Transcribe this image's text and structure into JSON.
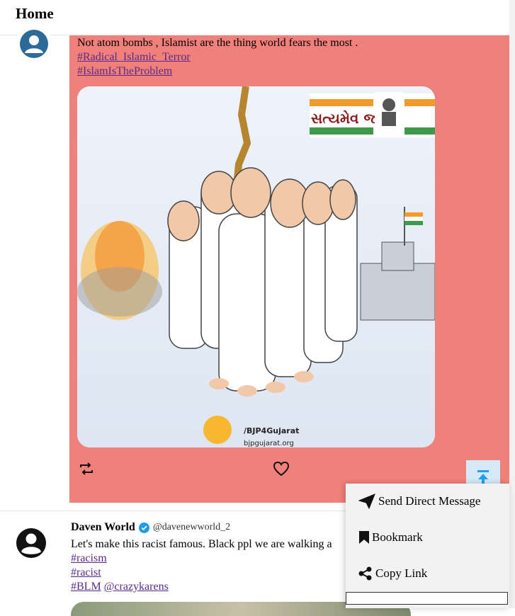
{
  "header": {
    "title": "Home"
  },
  "post1": {
    "text": "Not atom bombs , Islamist are the thing world fears the most .",
    "hashtags": [
      "#Radical_Islamic_Terror",
      "#IslamIsTheProblem"
    ],
    "image": {
      "banner_text": "સત્યમેવ જયતે",
      "social_handle": "/BJP4Gujarat",
      "website": "bjpgujarat.org"
    },
    "background_color": "#f0807b"
  },
  "post2": {
    "author": "Daven World",
    "handle": "@davenewworld_2",
    "text": "Let's make this racist famous. Black ppl we are walking a",
    "hashtags": [
      "#racism",
      "#racist"
    ],
    "last_line_tag": "#BLM",
    "last_line_mention": "@crazykarens"
  },
  "menu": {
    "items": [
      {
        "label": "Send Direct Message",
        "icon": "paper-plane-icon"
      },
      {
        "label": "Bookmark",
        "icon": "bookmark-icon"
      },
      {
        "label": "Copy Link",
        "icon": "share-icon"
      }
    ]
  },
  "colors": {
    "accent": "#1da1f2",
    "verified": "#1d9bf0",
    "post_highlight": "#f0807b"
  }
}
